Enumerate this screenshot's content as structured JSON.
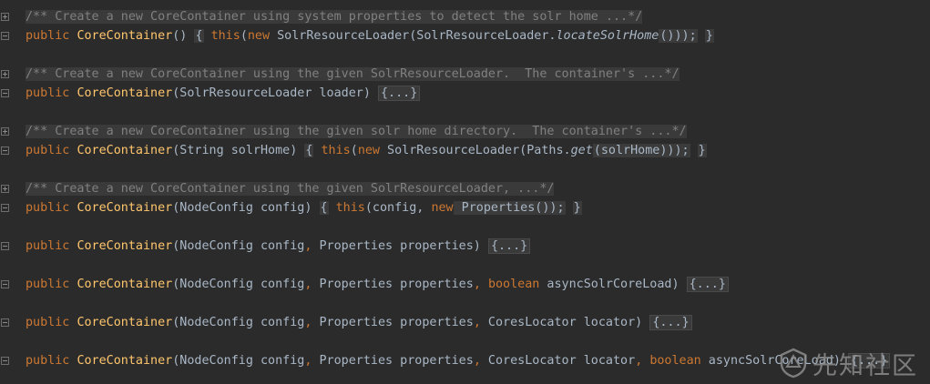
{
  "editor": {
    "blocks": [
      {
        "doc": "/** Create a new CoreContainer using system properties to detect the solr home ...*/",
        "code": {
          "modifier": "public",
          "name": "CoreContainer",
          "sig": "()",
          "open": "{",
          "kw_this": "this",
          "paren_open": "(",
          "kw_new": "new",
          "rest1": " SolrResourceLoader(SolrResourceLoader.",
          "method": "locateSolrHome",
          "rest2": "()));",
          "close": "}"
        }
      },
      {
        "doc": "/** Create a new CoreContainer using the given SolrResourceLoader.  The container's ...*/",
        "code": {
          "modifier": "public",
          "name": "CoreContainer",
          "sig": "(SolrResourceLoader loader)",
          "folded": "{...}"
        }
      },
      {
        "doc": "/** Create a new CoreContainer using the given solr home directory.  The container's ...*/",
        "code": {
          "modifier": "public",
          "name": "CoreContainer",
          "sig": "(String solrHome)",
          "open": "{",
          "kw_this": "this",
          "paren_open": "(",
          "kw_new": "new",
          "rest1": " SolrResourceLoader(Paths.",
          "method": "get",
          "rest2": "(solrHome)));",
          "close": "}"
        }
      },
      {
        "doc": "/** Create a new CoreContainer using the given SolrResourceLoader, ...*/",
        "code": {
          "modifier": "public",
          "name": "CoreContainer",
          "sig": "(NodeConfig config)",
          "open": "{",
          "kw_this": "this",
          "rest1": "(config, ",
          "kw_new": "new",
          "rest2": " Properties());",
          "close": "}"
        }
      }
    ],
    "lines": [
      {
        "modifier": "public",
        "name": "CoreContainer",
        "p1": "(NodeConfig config",
        "c1": ",",
        "p2": " Properties properties)",
        "folded": "{...}"
      },
      {
        "modifier": "public",
        "name": "CoreContainer",
        "p1": "(NodeConfig config",
        "c1": ",",
        "p2": " Properties properties",
        "c2": ",",
        "kw": "boolean",
        "p3": " asyncSolrCoreLoad)",
        "folded": "{...}"
      },
      {
        "modifier": "public",
        "name": "CoreContainer",
        "p1": "(NodeConfig config",
        "c1": ",",
        "p2": " Properties properties",
        "c2": ",",
        "p3": " CoresLocator locator)",
        "folded": "{...}"
      },
      {
        "modifier": "public",
        "name": "CoreContainer",
        "p1": "(NodeConfig config",
        "c1": ",",
        "p2": " Properties properties",
        "c2": ",",
        "p3": " CoresLocator locator",
        "c3": ",",
        "kw": "boolean",
        "p4": " asyncSolrCoreLoad)",
        "folded": "{...}"
      }
    ]
  },
  "watermark": {
    "text": "先知社区"
  },
  "colors": {
    "background": "#2b2b2b",
    "keyword": "#cc7832",
    "method_name": "#ffc66d",
    "comment": "#808080",
    "text": "#a9b7c6"
  }
}
